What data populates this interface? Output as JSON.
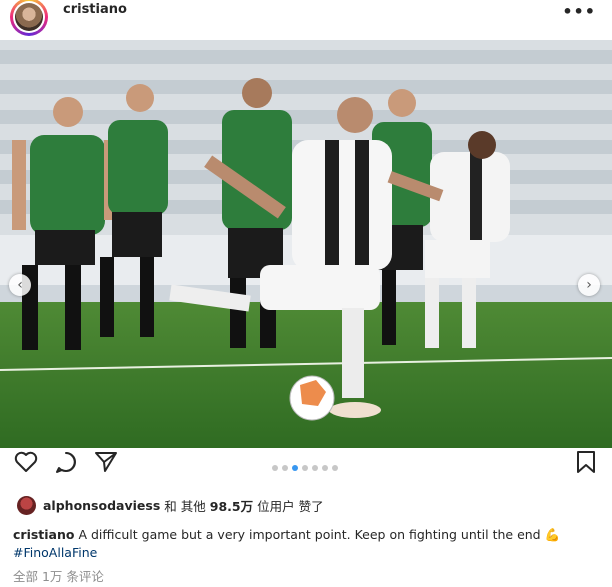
{
  "post": {
    "username": "cristiano",
    "more_label": "•••"
  },
  "photo": {
    "alt_brand_green": "#2e7d3c",
    "alt_brand_white": "#f4f4f4",
    "pitch_color": "#3f7d2c"
  },
  "carousel": {
    "prev_icon": "‹",
    "next_icon": "›",
    "active_index": 2,
    "count": 7
  },
  "actions": {
    "heart": "heart-icon",
    "comment": "comment-icon",
    "share": "share-icon",
    "bookmark": "bookmark-icon"
  },
  "likes": {
    "liker": "alphonsodaviess",
    "text_and": "和 其他",
    "count": "98.5万",
    "text_users_liked": "位用户 赞了"
  },
  "caption": {
    "user": "cristiano",
    "text": "A difficult game but a very important point. Keep on fighting until the end 💪",
    "hashtag": "#FinoAllaFine"
  },
  "comments": {
    "link": "全部 1万 条评论"
  },
  "colors": {
    "accent_blue": "#3897f0",
    "hashtag": "#00376b",
    "muted": "#8e8e8e"
  }
}
